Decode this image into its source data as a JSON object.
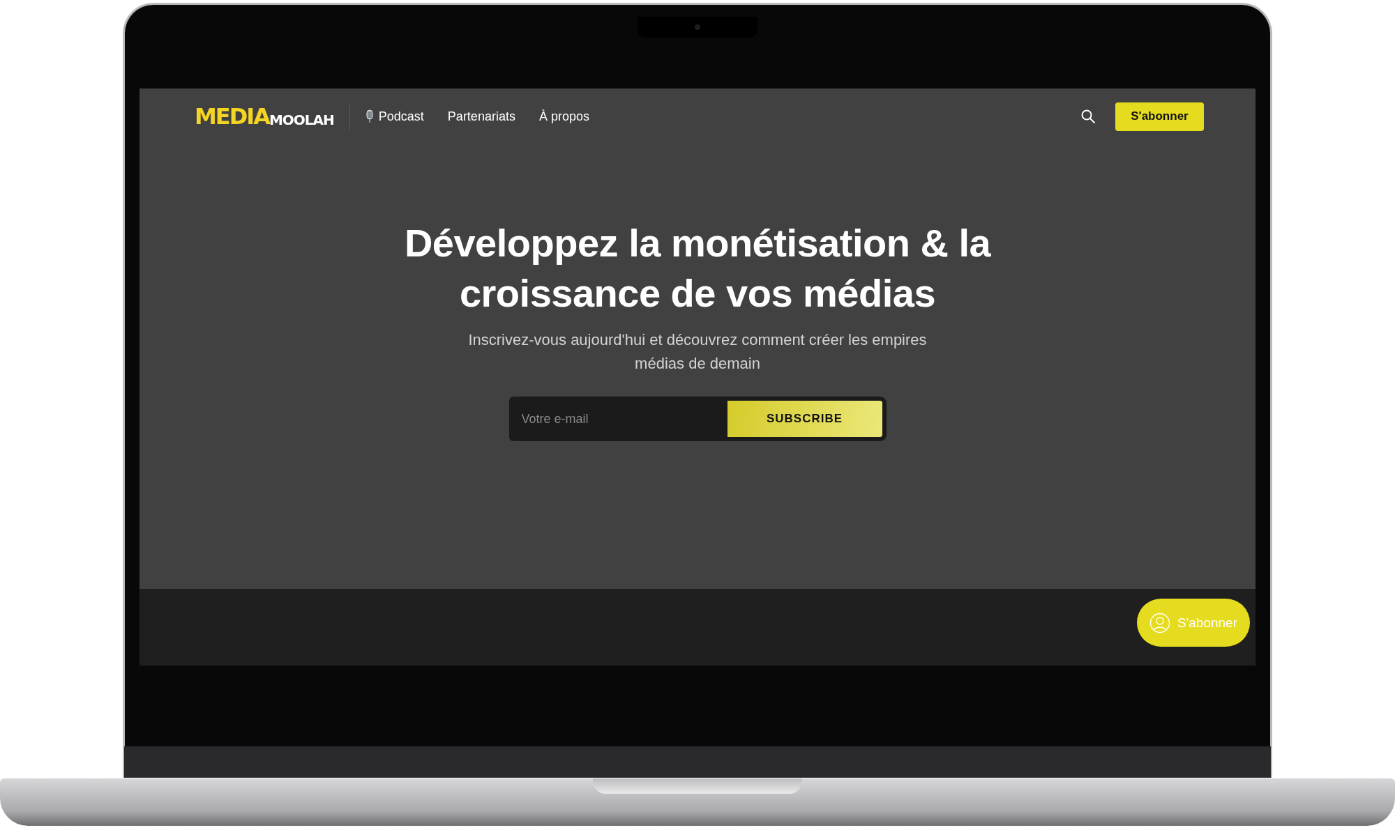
{
  "logo": {
    "part_1": "MEDIA",
    "part_2": "MOOLAH"
  },
  "nav": [
    {
      "label": "Podcast",
      "kind": "with-icon"
    },
    {
      "label": "Partenariats",
      "kind": "plain"
    },
    {
      "label": "À propos",
      "kind": "plain"
    }
  ],
  "subscribe_button": "S'abonner",
  "hero": {
    "title": "Développez la monétisation & la croissance de vos médias",
    "subtitle": "Inscrivez-vous aujourd'hui et découvrez comment créer les empires médias de demain"
  },
  "form": {
    "placeholder": "Votre e-mail",
    "button": "SUBSCRIBE"
  },
  "floating_button": "S'abonner"
}
